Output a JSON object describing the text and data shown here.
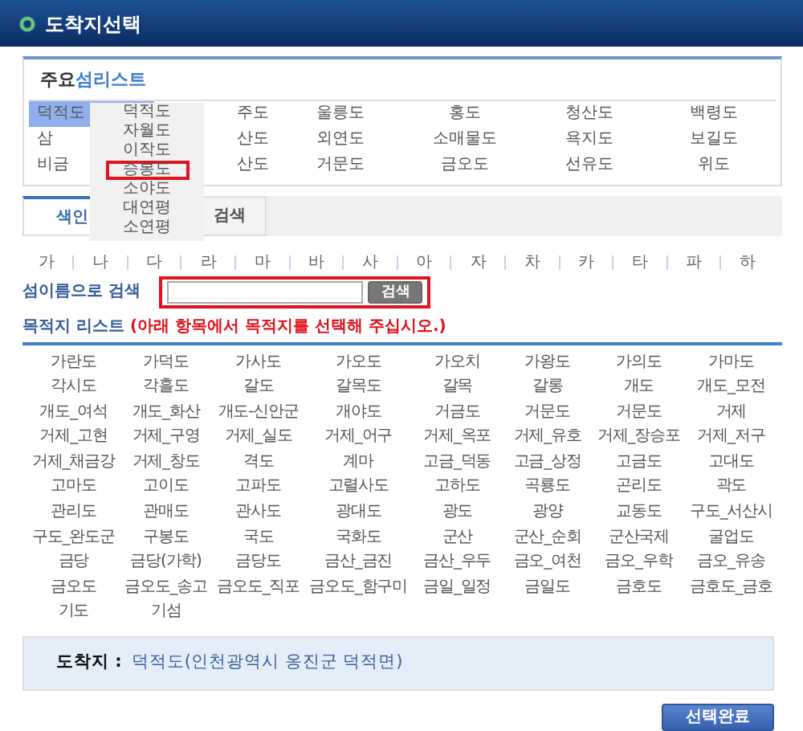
{
  "window": {
    "title": "도착지선택"
  },
  "major_islands": {
    "title_prefix": "주요",
    "title_accent": "섬리스트",
    "items": [
      {
        "label": "덕적도",
        "selected": true
      },
      {
        "label": "주도",
        "selected": false
      },
      {
        "label": "울릉도",
        "selected": false
      },
      {
        "label": "홍도",
        "selected": false
      },
      {
        "label": "청산도",
        "selected": false
      },
      {
        "label": "백령도",
        "selected": false
      },
      {
        "label": "삼",
        "selected": false
      },
      {
        "label": "산도",
        "selected": false
      },
      {
        "label": "외연도",
        "selected": false
      },
      {
        "label": "소매물도",
        "selected": false
      },
      {
        "label": "욕지도",
        "selected": false
      },
      {
        "label": "보길도",
        "selected": false
      },
      {
        "label": "비금",
        "selected": false
      },
      {
        "label": "산도",
        "selected": false
      },
      {
        "label": "거문도",
        "selected": false
      },
      {
        "label": "금오도",
        "selected": false
      },
      {
        "label": "선유도",
        "selected": false
      },
      {
        "label": "위도",
        "selected": false
      }
    ]
  },
  "island_dropdown": {
    "items": [
      {
        "label": "덕적도",
        "highlighted": false
      },
      {
        "label": "자월도",
        "highlighted": false
      },
      {
        "label": "이작도",
        "highlighted": false
      },
      {
        "label": "승봉도",
        "highlighted": true
      },
      {
        "label": "소야도",
        "highlighted": false
      },
      {
        "label": "대연평",
        "highlighted": false
      },
      {
        "label": "소연평",
        "highlighted": false
      }
    ]
  },
  "tabs": [
    {
      "label": "색인",
      "selected": true
    },
    {
      "label": "검색",
      "selected": false
    }
  ],
  "index_letters": [
    "가",
    "나",
    "다",
    "라",
    "마",
    "바",
    "사",
    "아",
    "자",
    "차",
    "카",
    "타",
    "파",
    "하"
  ],
  "name_search": {
    "label": "섬이름으로 검색",
    "button": "검색",
    "highlighted": true
  },
  "destination_list": {
    "title": "목적지 리스트",
    "note": "(아래 항목에서 목적지를 선택해 주십시오.)",
    "items": [
      "가란도",
      "가덕도",
      "가사도",
      "가오도",
      "가오치",
      "가왕도",
      "가의도",
      "가마도",
      "각시도",
      "각흘도",
      "갈도",
      "갈목도",
      "갈목",
      "갈롱",
      "개도",
      "개도_모전",
      "개도_여석",
      "개도_화산",
      "개도-신안군",
      "개야도",
      "거금도",
      "거문도",
      "거문도",
      "거제",
      "거제_고현",
      "거제_구영",
      "거제_실도",
      "거제_어구",
      "거제_옥포",
      "거제_유호",
      "거제_장승포",
      "거제_저구",
      "거제_채금강",
      "거제_창도",
      "격도",
      "계마",
      "고금_덕동",
      "고금_상정",
      "고금도",
      "고대도",
      "고마도",
      "고이도",
      "고파도",
      "고렬사도",
      "고하도",
      "곡룡도",
      "곤리도",
      "곽도",
      "관리도",
      "관매도",
      "관사도",
      "광대도",
      "광도",
      "광양",
      "교동도",
      "구도_서산시",
      "구도_완도군",
      "구봉도",
      "국도",
      "국화도",
      "군산",
      "군산_순회",
      "군산국제",
      "굴업도",
      "금당",
      "금당(가학)",
      "금당도",
      "금산_금진",
      "금산_우두",
      "금오_여천",
      "금오_우학",
      "금오_유송",
      "금오도",
      "금오도_송고",
      "금오도_직포",
      "금오도_함구미",
      "금일_일정",
      "금일도",
      "금호도",
      "금호도_금호",
      "기도",
      "기섬"
    ]
  },
  "destination": {
    "label": "도착지 :",
    "value": "덕적도(인천광역시 옹진군 덕적면)"
  },
  "buttons": [
    "선택완료"
  ]
}
